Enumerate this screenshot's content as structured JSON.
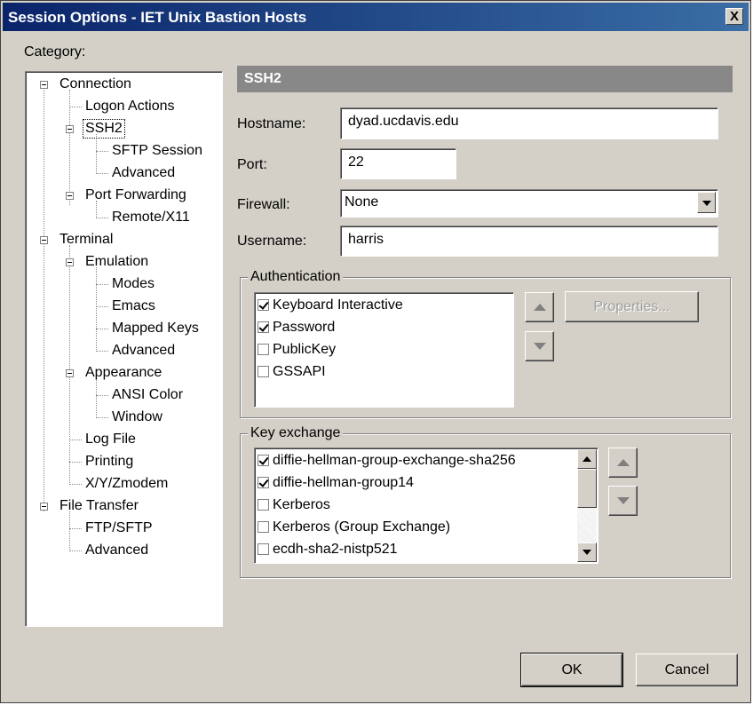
{
  "window": {
    "title": "Session Options - IET Unix Bastion Hosts",
    "close_label": "X"
  },
  "category_label": "Category:",
  "tree": [
    {
      "label": "Connection"
    },
    {
      "label": "Logon Actions"
    },
    {
      "label": "SSH2"
    },
    {
      "label": "SFTP Session"
    },
    {
      "label": "Advanced"
    },
    {
      "label": "Port Forwarding"
    },
    {
      "label": "Remote/X11"
    },
    {
      "label": "Terminal"
    },
    {
      "label": "Emulation"
    },
    {
      "label": "Modes"
    },
    {
      "label": "Emacs"
    },
    {
      "label": "Mapped Keys"
    },
    {
      "label": "Advanced"
    },
    {
      "label": "Appearance"
    },
    {
      "label": "ANSI Color"
    },
    {
      "label": "Window"
    },
    {
      "label": "Log File"
    },
    {
      "label": "Printing"
    },
    {
      "label": "X/Y/Zmodem"
    },
    {
      "label": "File Transfer"
    },
    {
      "label": "FTP/SFTP"
    },
    {
      "label": "Advanced"
    }
  ],
  "panel": {
    "header": "SSH2",
    "hostname_label": "Hostname:",
    "hostname_value": "dyad.ucdavis.edu",
    "port_label": "Port:",
    "port_value": "22",
    "firewall_label": "Firewall:",
    "firewall_value": "None",
    "username_label": "Username:",
    "username_value": "harris"
  },
  "authentication": {
    "legend": "Authentication",
    "items": [
      {
        "label": "Keyboard Interactive",
        "checked": true
      },
      {
        "label": "Password",
        "checked": true
      },
      {
        "label": "PublicKey",
        "checked": false
      },
      {
        "label": "GSSAPI",
        "checked": false
      }
    ],
    "properties_label": "Properties..."
  },
  "key_exchange": {
    "legend": "Key exchange",
    "items": [
      {
        "label": "diffie-hellman-group-exchange-sha256",
        "checked": true
      },
      {
        "label": "diffie-hellman-group14",
        "checked": true
      },
      {
        "label": "Kerberos",
        "checked": false
      },
      {
        "label": "Kerberos (Group Exchange)",
        "checked": false
      },
      {
        "label": "ecdh-sha2-nistp521",
        "checked": false
      }
    ]
  },
  "buttons": {
    "ok": "OK",
    "cancel": "Cancel"
  }
}
